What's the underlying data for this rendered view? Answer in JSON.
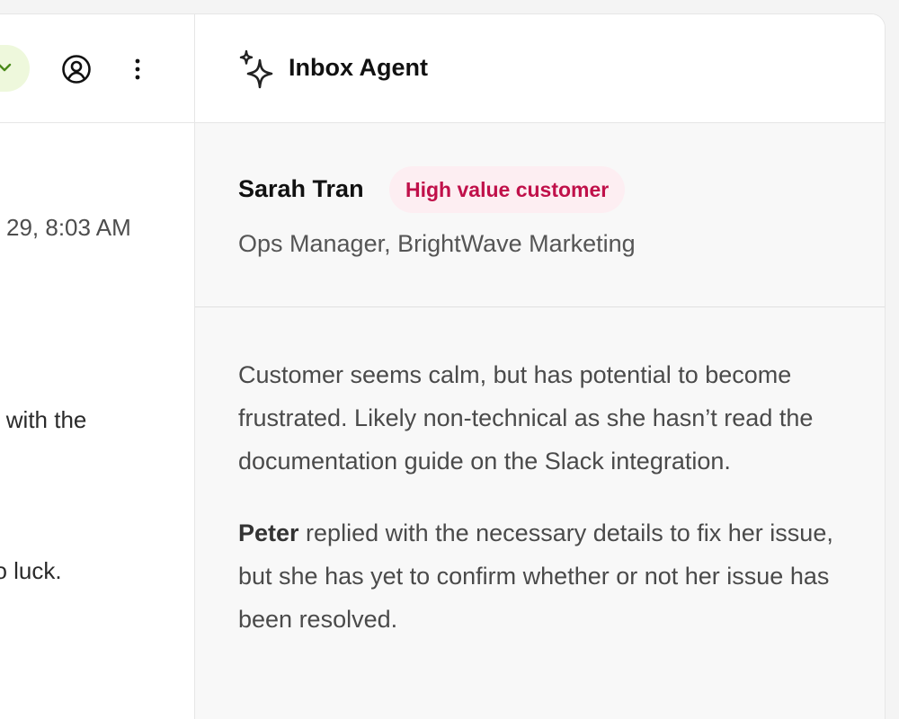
{
  "left": {
    "timestamp": "29, 8:03 AM",
    "line1": "ils with the",
    "line2": "no luck."
  },
  "agent": {
    "title": "Inbox Agent",
    "customer": {
      "name": "Sarah Tran",
      "badge": "High value customer",
      "role": "Ops Manager, BrightWave Marketing"
    },
    "summary": {
      "para1": "Customer seems calm, but has potential to become frustrated. Likely non-technical as she hasn’t read the documentation guide on the Slack integration.",
      "para2_name": "Peter",
      "para2_rest": " replied with the necessary details to fix her issue, but she has yet to confirm whether or not her issue has been resolved."
    }
  },
  "icons": {
    "status": "chevron-down-icon",
    "account": "user-circle-icon",
    "more": "more-vertical-icon",
    "agent": "sparkle-icon"
  },
  "colors": {
    "badge_text": "#c0104a",
    "badge_bg": "#fdeef2",
    "status_pill_bg": "#eef8dc",
    "status_chevron": "#4a8a1a"
  }
}
